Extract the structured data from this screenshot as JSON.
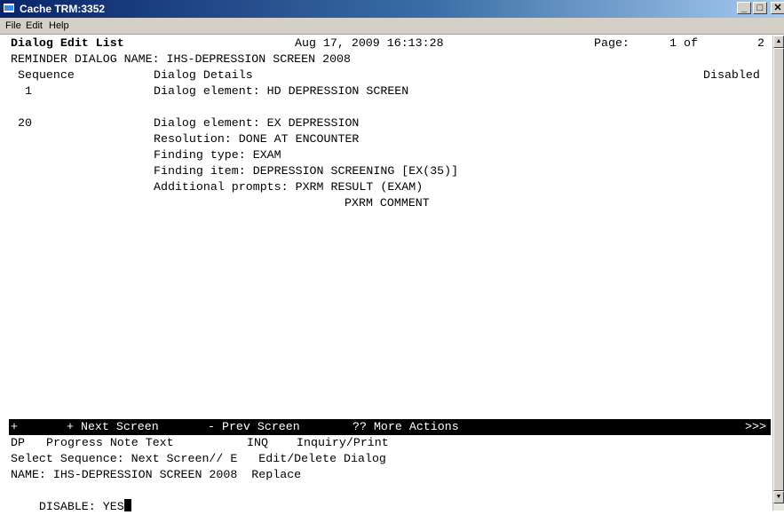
{
  "window": {
    "title": "Cache TRM:3352",
    "min": "_",
    "max": "□",
    "close": "✕"
  },
  "menu": {
    "file": "File",
    "edit": "Edit",
    "help": "Help"
  },
  "header": {
    "title": "Dialog Edit List",
    "datetime": "Aug 17, 2009 16:13:28",
    "page_label": "Page:",
    "page_current": "1 of",
    "page_total": "2"
  },
  "reminder": "REMINDER DIALOG NAME: IHS-DEPRESSION SCREEN 2008",
  "columns": {
    "sequence": "Sequence",
    "details": "Dialog Details",
    "disabled": "Disabled"
  },
  "rows": [
    {
      "seq": "1",
      "details": [
        "Dialog element: HD DEPRESSION SCREEN"
      ]
    },
    {
      "seq": "20",
      "details": [
        "Dialog element: EX DEPRESSION",
        "Resolution: DONE AT ENCOUNTER",
        "Finding type: EXAM",
        "Finding item: DEPRESSION SCREENING [EX(35)]",
        "Additional prompts: PXRM RESULT (EXAM)",
        "PXRM COMMENT"
      ]
    }
  ],
  "actionbar": {
    "plus": "+",
    "next": "+ Next Screen",
    "prev": "- Prev Screen",
    "more": "?? More Actions",
    "arrows": ">>>"
  },
  "actions": {
    "dp_code": "DP",
    "dp_label": "Progress Note Text",
    "inq_code": "INQ",
    "inq_label": "Inquiry/Print"
  },
  "prompts": {
    "select": "Select Sequence: Next Screen// E   Edit/Delete Dialog",
    "name": "NAME: IHS-DEPRESSION SCREEN 2008  Replace",
    "disable": "DISABLE: YES"
  },
  "scrollbar": {
    "up": "▲",
    "down": "▼"
  }
}
